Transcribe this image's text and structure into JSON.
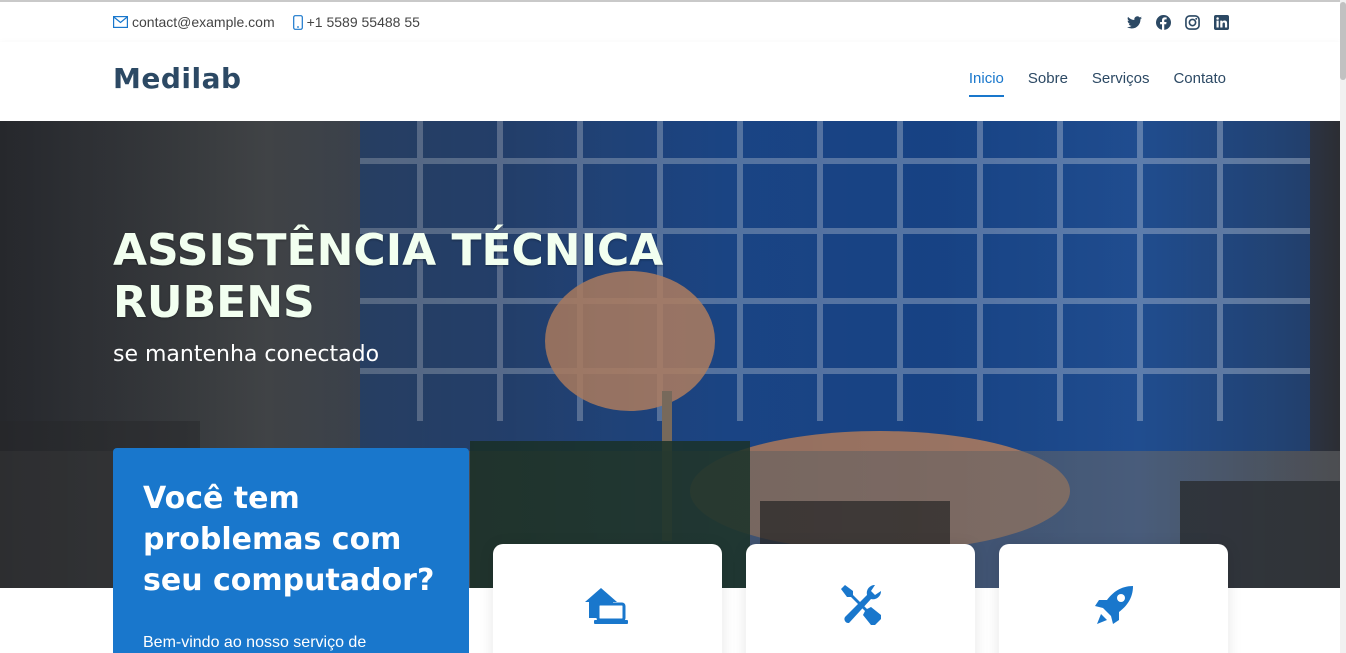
{
  "topbar": {
    "email": "contact@example.com",
    "phone": "+1 5589 55488 55",
    "social": [
      "twitter-icon",
      "facebook-icon",
      "instagram-icon",
      "linkedin-icon"
    ]
  },
  "header": {
    "logo": "Medilab",
    "nav": [
      {
        "label": "Inicio",
        "active": true
      },
      {
        "label": "Sobre",
        "active": false
      },
      {
        "label": "Serviços",
        "active": false
      },
      {
        "label": "Contato",
        "active": false
      }
    ]
  },
  "hero": {
    "title": "ASSISTÊNCIA TÉCNICA RUBENS",
    "subtitle": "se mantenha conectado"
  },
  "why": {
    "heading": "Você tem problemas com seu computador?",
    "text": "Bem-vindo ao nosso serviço de"
  },
  "cards": [
    {
      "icon": "home-laptop-icon"
    },
    {
      "icon": "tools-icon"
    },
    {
      "icon": "rocket-icon"
    }
  ],
  "colors": {
    "accent": "#1977cc",
    "heading": "#2c4964",
    "text": "#444444"
  }
}
